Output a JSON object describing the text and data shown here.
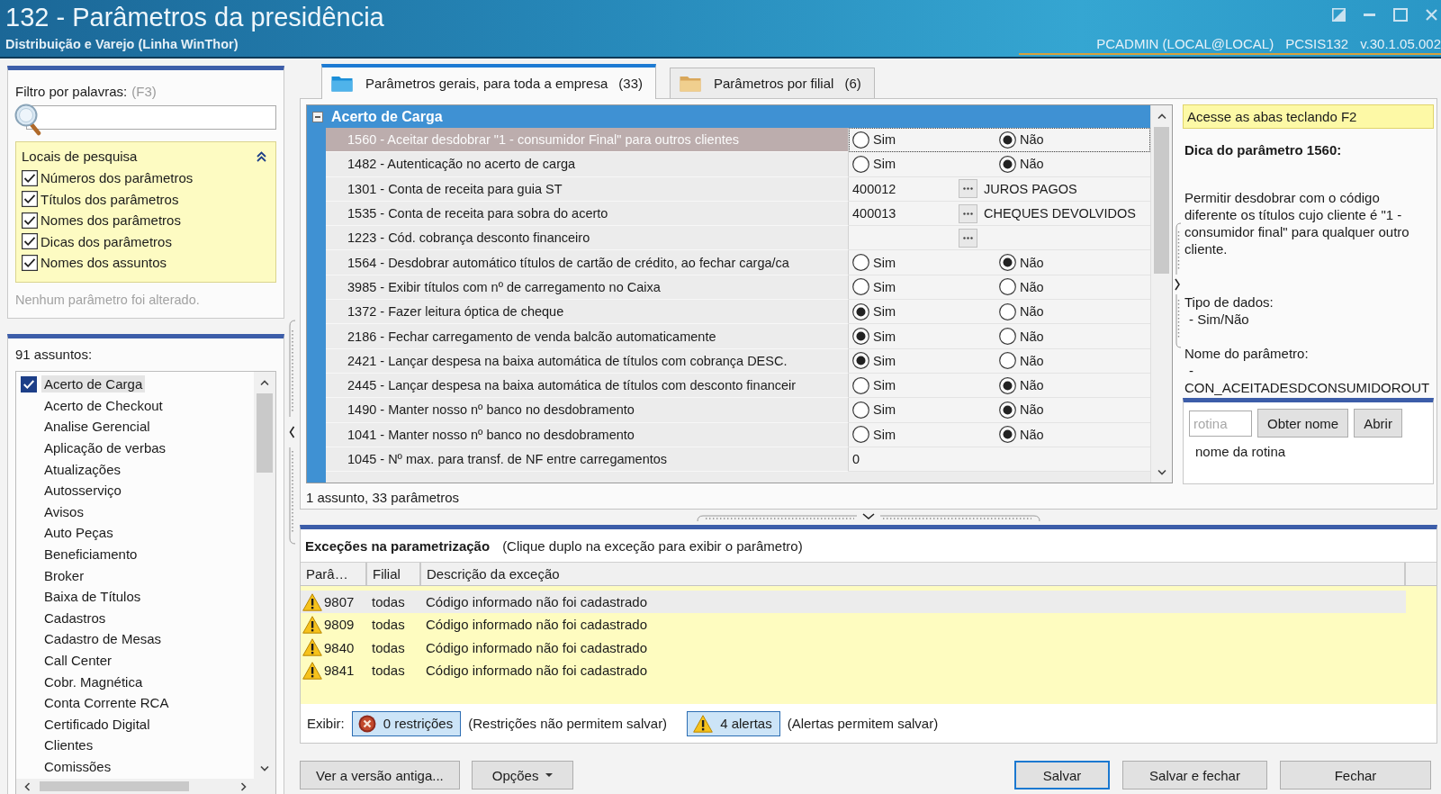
{
  "window": {
    "title": "132 - Parâmetros da presidência",
    "subtitle": "Distribuição e Varejo (Linha WinThor)",
    "user": "PCADMIN (LOCAL@LOCAL)",
    "routine": "PCSIS132",
    "version": "v.30.1.05.002"
  },
  "filter": {
    "label": "Filtro por palavras:",
    "shortcut": "(F3)",
    "search_locations": {
      "title": "Locais de pesquisa",
      "expanded": true,
      "options": [
        {
          "label": "Números dos parâmetros",
          "checked": true
        },
        {
          "label": "Títulos dos parâmetros",
          "checked": true
        },
        {
          "label": "Nomes dos parâmetros",
          "checked": true
        },
        {
          "label": "Dicas dos parâmetros",
          "checked": true
        },
        {
          "label": "Nomes dos assuntos",
          "checked": true
        }
      ]
    },
    "status": "Nenhum parâmetro foi alterado."
  },
  "subjects": {
    "count_label": "91 assuntos:",
    "items": [
      {
        "label": "Acerto de Carga",
        "selected": true
      },
      {
        "label": "Acerto de Checkout",
        "selected": false
      },
      {
        "label": "Analise Gerencial",
        "selected": false
      },
      {
        "label": "Aplicação de verbas",
        "selected": false
      },
      {
        "label": "Atualizações",
        "selected": false
      },
      {
        "label": "Autosserviço",
        "selected": false
      },
      {
        "label": "Avisos",
        "selected": false
      },
      {
        "label": "Auto Peças",
        "selected": false
      },
      {
        "label": "Beneficiamento",
        "selected": false
      },
      {
        "label": "Broker",
        "selected": false
      },
      {
        "label": "Baixa de Títulos",
        "selected": false
      },
      {
        "label": "Cadastros",
        "selected": false
      },
      {
        "label": "Cadastro de Mesas",
        "selected": false
      },
      {
        "label": "Call Center",
        "selected": false
      },
      {
        "label": "Cobr. Magnética",
        "selected": false
      },
      {
        "label": "Conta Corrente RCA",
        "selected": false
      },
      {
        "label": "Certificado Digital",
        "selected": false
      },
      {
        "label": "Clientes",
        "selected": false
      },
      {
        "label": "Comissões",
        "selected": false
      }
    ]
  },
  "tabs": [
    {
      "kind": "general",
      "label": "Parâmetros gerais, para toda a empresa",
      "count": "(33)",
      "selected": true
    },
    {
      "kind": "branch",
      "label": "Parâmetros por filial",
      "count": "(6)",
      "selected": false
    }
  ],
  "parameter_grid": {
    "group": {
      "title": "Acerto de Carga",
      "expanded": true
    },
    "rows": [
      {
        "kind": "yesno",
        "label": "1560 - Aceitar desdobrar \"1 - consumidor Final\" para outros clientes",
        "selected": true,
        "options": [
          {
            "label": "Sim",
            "selected": false
          },
          {
            "label": "Não",
            "selected": true
          }
        ]
      },
      {
        "kind": "yesno",
        "label": "1482 - Autenticação no acerto de carga",
        "selected": false,
        "options": [
          {
            "label": "Sim",
            "selected": false
          },
          {
            "label": "Não",
            "selected": true
          }
        ]
      },
      {
        "kind": "lookup",
        "label": "1301 - Conta de receita para guia ST",
        "selected": false,
        "value": "400012",
        "description": "JUROS PAGOS"
      },
      {
        "kind": "lookup",
        "label": "1535 - Conta de receita para sobra do acerto",
        "selected": false,
        "value": "400013",
        "description": "CHEQUES DEVOLVIDOS"
      },
      {
        "kind": "lookup",
        "label": "1223 - Cód. cobrança desconto financeiro",
        "selected": false
      },
      {
        "kind": "yesno",
        "label": "1564 - Desdobrar automático títulos de cartão de crédito, ao fechar carga/ca",
        "selected": false,
        "options": [
          {
            "label": "Sim",
            "selected": false
          },
          {
            "label": "Não",
            "selected": true
          }
        ]
      },
      {
        "kind": "yesno",
        "label": "3985 - Exibir títulos com nº de carregamento no Caixa",
        "selected": false,
        "options": [
          {
            "label": "Sim",
            "selected": false
          },
          {
            "label": "Não",
            "selected": false
          }
        ]
      },
      {
        "kind": "yesno",
        "label": "1372 - Fazer leitura óptica de cheque",
        "selected": false,
        "options": [
          {
            "label": "Sim",
            "selected": true
          },
          {
            "label": "Não",
            "selected": false
          }
        ]
      },
      {
        "kind": "yesno",
        "label": "2186 - Fechar carregamento de venda balcão automaticamente",
        "selected": false,
        "options": [
          {
            "label": "Sim",
            "selected": true
          },
          {
            "label": "Não",
            "selected": false
          }
        ]
      },
      {
        "kind": "yesno",
        "label": "2421 - Lançar despesa na baixa automática de títulos com cobrança DESC.",
        "selected": false,
        "options": [
          {
            "label": "Sim",
            "selected": true
          },
          {
            "label": "Não",
            "selected": false
          }
        ]
      },
      {
        "kind": "yesno",
        "label": "2445 - Lançar despesa na baixa automática de títulos com desconto financeir",
        "selected": false,
        "options": [
          {
            "label": "Sim",
            "selected": false
          },
          {
            "label": "Não",
            "selected": true
          }
        ]
      },
      {
        "kind": "yesno",
        "label": "1490 - Manter nosso nº banco no desdobramento",
        "selected": false,
        "options": [
          {
            "label": "Sim",
            "selected": false
          },
          {
            "label": "Não",
            "selected": true
          }
        ]
      },
      {
        "kind": "yesno",
        "label": "1041 - Manter nosso nº banco no desdobramento",
        "selected": false,
        "options": [
          {
            "label": "Sim",
            "selected": false
          },
          {
            "label": "Não",
            "selected": true
          }
        ]
      },
      {
        "kind": "text",
        "label": "1045 - Nº max. para transf. de NF entre carregamentos",
        "selected": false,
        "value": "0"
      }
    ]
  },
  "grid_status": "1 assunto, 33 parâmetros",
  "hint": {
    "notice": "Acesse as abas teclando F2",
    "title": "Dica do parâmetro 1560:",
    "description": "Permitir desdobrar com o código diferente os títulos cujo cliente é \"1 - consumidor final\" para qualquer outro cliente.",
    "data_type_label": "Tipo de dados:",
    "data_type": "- Sim/Não",
    "name_label": "Nome do parâmetro:",
    "name_lines": [
      "-",
      "CON_ACEITADESDCONSUMIDOROUT"
    ]
  },
  "routine_lookup": {
    "placeholder": "rotina",
    "buttons": [
      "Obter nome",
      "Abrir"
    ],
    "result": "nome da rotina"
  },
  "exceptions": {
    "title": "Exceções na parametrização",
    "hint": "(Clique duplo na exceção para exibir o parâmetro)",
    "columns": [
      "Parâ…",
      "Filial",
      "Descrição da exceção"
    ],
    "rows": [
      {
        "kind": "alert",
        "parameter": "9807",
        "branch": "todas",
        "description": "Código informado não foi cadastrado",
        "selected": true
      },
      {
        "kind": "alert",
        "parameter": "9809",
        "branch": "todas",
        "description": "Código informado não foi cadastrado",
        "selected": false
      },
      {
        "kind": "alert",
        "parameter": "9840",
        "branch": "todas",
        "description": "Código informado não foi cadastrado",
        "selected": false
      },
      {
        "kind": "alert",
        "parameter": "9841",
        "branch": "todas",
        "description": "Código informado não foi cadastrado",
        "selected": false
      }
    ],
    "filter_label": "Exibir:",
    "filters": [
      {
        "kind": "restriction",
        "label": "0 restrições",
        "on": true,
        "note": "(Restrições não permitem salvar)"
      },
      {
        "kind": "alert",
        "label": "4 alertas",
        "on": true,
        "note": "(Alertas permitem salvar)"
      }
    ]
  },
  "footer": {
    "left_buttons": [
      {
        "kind": "plain",
        "label": "Ver a versão antiga..."
      },
      {
        "kind": "menu",
        "label": "Opções"
      }
    ],
    "right_buttons": [
      {
        "label": "Salvar",
        "default": true
      },
      {
        "label": "Salvar e fechar",
        "default": false
      },
      {
        "label": "Fechar",
        "default": false
      }
    ]
  }
}
